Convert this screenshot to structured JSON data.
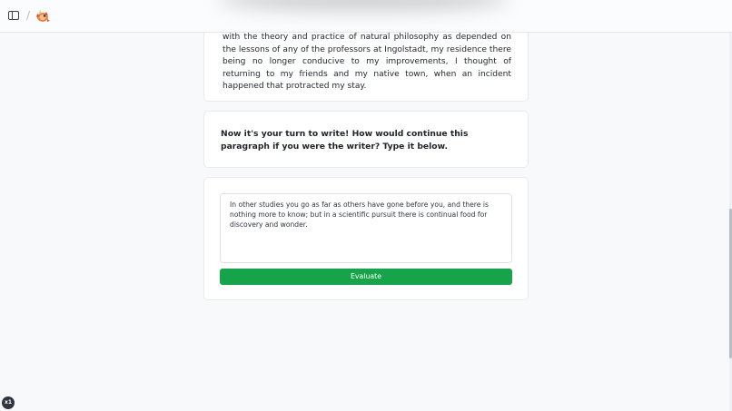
{
  "header": {
    "toggle_icon": "sidebar-toggle-icon",
    "separator": "/",
    "logo_icon": "fish-mascot-logo"
  },
  "passage": {
    "text": "with the theory and practice of natural philosophy as depended on the lessons of any of the professors at Ingolstadt, my residence there being no longer conducive to my improvements, I thought of returning to my friends and my native town, when an incident happened that protracted my stay."
  },
  "prompt": {
    "text": "Now it's your turn to write! How would continue this paragraph if you were the writer? Type it below."
  },
  "answer": {
    "value": "In other studies you go as far as others have gone before you, and there is nothing more to know; but in a scientific pursuit there is continual food for discovery and wonder.",
    "evaluate_label": "Evaluate"
  },
  "zoom_badge": "x1",
  "colors": {
    "accent_green": "#16a34a",
    "page_bg": "#f8f9fb",
    "card_bg": "#ffffff"
  }
}
